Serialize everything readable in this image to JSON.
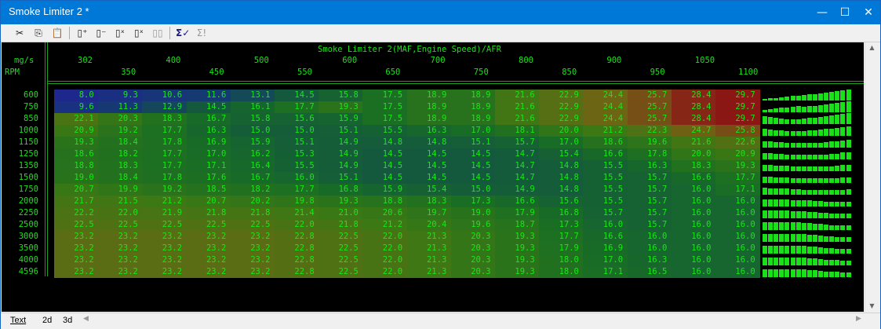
{
  "window": {
    "title": "Smoke Limiter 2 *",
    "minimize_glyph": "—",
    "maximize_glyph": "☐",
    "close_glyph": "✕"
  },
  "toolbar": {
    "icons": [
      "cut-icon",
      "copy-icon",
      "paste-icon",
      "insert-column-icon",
      "delete-column-icon",
      "clear-column-icon",
      "clear-row-icon",
      "clone-icon",
      "sigma-check-icon",
      "sigma-run-icon"
    ]
  },
  "map": {
    "title": "Smoke Limiter 2(MAF,Engine Speed)/AFR",
    "x_axis_name": "mg/s",
    "y_axis_name": "RPM",
    "x_top": [
      "302",
      "400",
      "500",
      "600",
      "700",
      "800",
      "900",
      "1050"
    ],
    "x_bottom": [
      "350",
      "450",
      "550",
      "650",
      "750",
      "850",
      "950",
      "1100"
    ],
    "rows": [
      "600",
      "750",
      "850",
      "1000",
      "1150",
      "1250",
      "1350",
      "1500",
      "1750",
      "2000",
      "2250",
      "2500",
      "3000",
      "3500",
      "4000",
      "4596"
    ],
    "values": [
      [
        "8.0",
        "9.3",
        "10.6",
        "11.6",
        "13.1",
        "14.5",
        "15.8",
        "17.5",
        "18.9",
        "18.9",
        "21.6",
        "22.9",
        "24.4",
        "25.7",
        "28.4",
        "29.7"
      ],
      [
        "9.6",
        "11.3",
        "12.9",
        "14.5",
        "16.1",
        "17.7",
        "19.3",
        "17.5",
        "18.9",
        "18.9",
        "21.6",
        "22.9",
        "24.4",
        "25.7",
        "28.4",
        "29.7"
      ],
      [
        "22.1",
        "20.3",
        "18.3",
        "16.7",
        "15.8",
        "15.6",
        "15.9",
        "17.5",
        "18.9",
        "18.9",
        "21.6",
        "22.9",
        "24.4",
        "25.7",
        "28.4",
        "29.7"
      ],
      [
        "20.9",
        "19.2",
        "17.7",
        "16.3",
        "15.0",
        "15.0",
        "15.1",
        "15.5",
        "16.3",
        "17.0",
        "18.1",
        "20.0",
        "21.2",
        "22.3",
        "24.7",
        "25.8"
      ],
      [
        "19.3",
        "18.4",
        "17.8",
        "16.9",
        "15.9",
        "15.1",
        "14.9",
        "14.8",
        "14.8",
        "15.1",
        "15.7",
        "17.0",
        "18.6",
        "19.6",
        "21.6",
        "22.6"
      ],
      [
        "18.6",
        "18.2",
        "17.7",
        "17.0",
        "16.2",
        "15.3",
        "14.9",
        "14.5",
        "14.5",
        "14.5",
        "14.7",
        "15.4",
        "16.6",
        "17.8",
        "20.0",
        "20.9"
      ],
      [
        "18.8",
        "18.3",
        "17.7",
        "17.1",
        "16.4",
        "15.5",
        "14.9",
        "14.5",
        "14.5",
        "14.5",
        "14.7",
        "14.8",
        "15.5",
        "16.3",
        "18.3",
        "19.3"
      ],
      [
        "19.0",
        "18.4",
        "17.8",
        "17.6",
        "16.7",
        "16.0",
        "15.1",
        "14.5",
        "14.5",
        "14.5",
        "14.7",
        "14.8",
        "15.5",
        "15.7",
        "16.6",
        "17.7"
      ],
      [
        "20.7",
        "19.9",
        "19.2",
        "18.5",
        "18.2",
        "17.7",
        "16.8",
        "15.9",
        "15.4",
        "15.0",
        "14.9",
        "14.8",
        "15.5",
        "15.7",
        "16.0",
        "17.1"
      ],
      [
        "21.7",
        "21.5",
        "21.2",
        "20.7",
        "20.2",
        "19.8",
        "19.3",
        "18.8",
        "18.3",
        "17.3",
        "16.6",
        "15.6",
        "15.5",
        "15.7",
        "16.0",
        "16.0"
      ],
      [
        "22.2",
        "22.0",
        "21.9",
        "21.8",
        "21.8",
        "21.4",
        "21.0",
        "20.6",
        "19.7",
        "19.0",
        "17.9",
        "16.8",
        "15.7",
        "15.7",
        "16.0",
        "16.0"
      ],
      [
        "22.5",
        "22.5",
        "22.5",
        "22.5",
        "22.5",
        "22.0",
        "21.8",
        "21.2",
        "20.4",
        "19.6",
        "18.7",
        "17.3",
        "16.0",
        "15.7",
        "16.0",
        "16.0"
      ],
      [
        "23.2",
        "23.2",
        "23.2",
        "23.2",
        "23.2",
        "22.8",
        "22.5",
        "22.0",
        "21.3",
        "20.3",
        "19.3",
        "17.7",
        "16.6",
        "16.0",
        "16.0",
        "16.0"
      ],
      [
        "23.2",
        "23.2",
        "23.2",
        "23.2",
        "23.2",
        "22.8",
        "22.5",
        "22.0",
        "21.3",
        "20.3",
        "19.3",
        "17.9",
        "16.9",
        "16.0",
        "16.0",
        "16.0"
      ],
      [
        "23.2",
        "23.2",
        "23.2",
        "23.2",
        "23.2",
        "22.8",
        "22.5",
        "22.0",
        "21.3",
        "20.3",
        "19.3",
        "18.0",
        "17.0",
        "16.3",
        "16.0",
        "16.0"
      ],
      [
        "23.2",
        "23.2",
        "23.2",
        "23.2",
        "23.2",
        "22.8",
        "22.5",
        "22.0",
        "21.3",
        "20.3",
        "19.3",
        "18.0",
        "17.1",
        "16.5",
        "16.0",
        "16.0"
      ]
    ]
  },
  "tabs": [
    {
      "label": "Text",
      "active": true
    },
    {
      "label": "2d",
      "active": false
    },
    {
      "label": "3d",
      "active": false
    }
  ]
}
